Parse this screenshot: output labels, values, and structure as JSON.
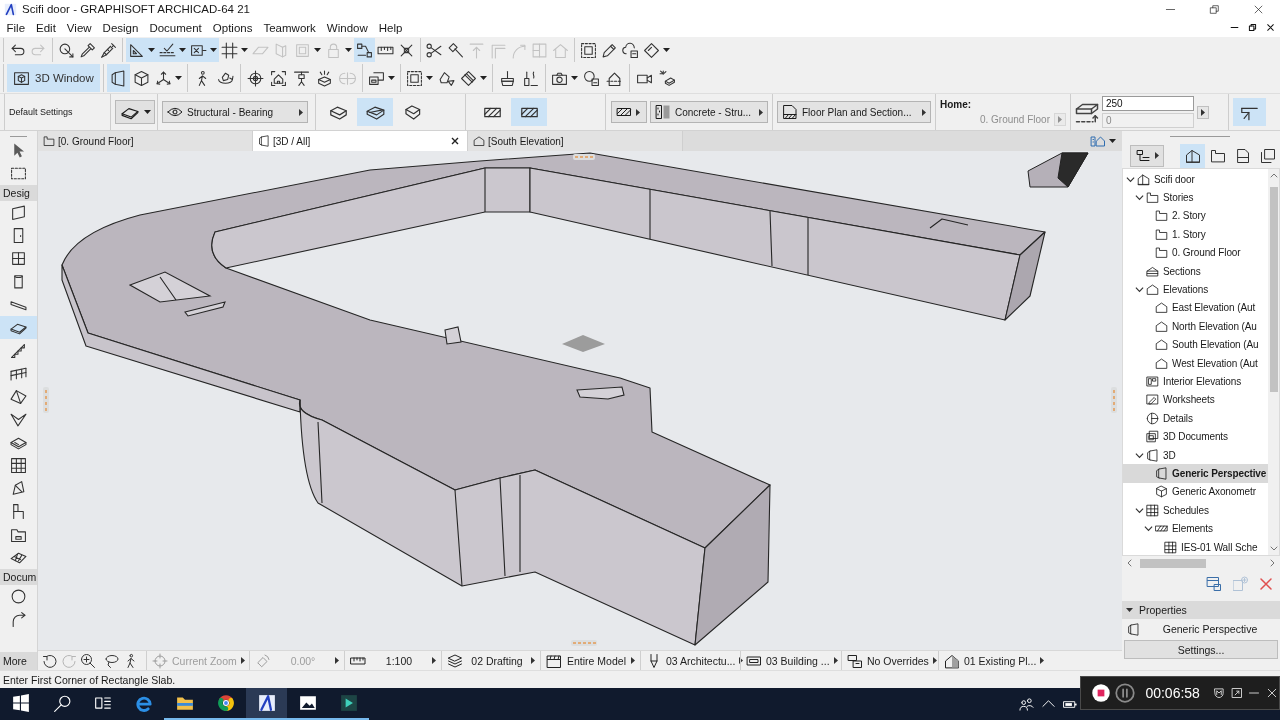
{
  "window": {
    "title": "Scifi door - GRAPHISOFT ARCHICAD-64 21"
  },
  "menu": [
    "File",
    "Edit",
    "View",
    "Design",
    "Document",
    "Options",
    "Teamwork",
    "Window",
    "Help"
  ],
  "toolbars": [
    {
      "groups": [
        [
          {
            "kind": "button",
            "on": false,
            "disabled": false
          },
          {
            "kind": "button",
            "on": false,
            "disabled": true
          }
        ],
        [
          {
            "kind": "button",
            "on": false,
            "disabled": false
          },
          {
            "kind": "button",
            "on": false,
            "disabled": false
          },
          {
            "kind": "button",
            "on": false,
            "disabled": false
          }
        ],
        [
          {
            "kind": "split",
            "on": true,
            "disabled": false
          },
          {
            "kind": "split",
            "on": true,
            "disabled": false
          },
          {
            "kind": "split",
            "on": true,
            "disabled": false
          },
          {
            "kind": "split",
            "on": false,
            "disabled": false
          },
          {
            "kind": "button",
            "on": false,
            "disabled": true
          },
          {
            "kind": "button",
            "on": false,
            "disabled": true
          },
          {
            "kind": "split",
            "on": false,
            "disabled": true
          },
          {
            "kind": "split",
            "on": false,
            "disabled": true
          },
          {
            "kind": "button",
            "on": true,
            "disabled": false
          },
          {
            "kind": "button",
            "on": false,
            "disabled": false
          },
          {
            "kind": "button",
            "on": false,
            "disabled": false
          }
        ],
        [
          {
            "kind": "button",
            "on": false,
            "disabled": false
          },
          {
            "kind": "button",
            "on": false,
            "disabled": false
          },
          {
            "kind": "button",
            "on": false,
            "disabled": true
          },
          {
            "kind": "button",
            "on": false,
            "disabled": true
          },
          {
            "kind": "button",
            "on": false,
            "disabled": true
          },
          {
            "kind": "button",
            "on": false,
            "disabled": true
          },
          {
            "kind": "button",
            "on": false,
            "disabled": true
          }
        ],
        [
          {
            "kind": "button",
            "on": false,
            "disabled": false
          },
          {
            "kind": "button",
            "on": false,
            "disabled": false
          },
          {
            "kind": "button",
            "on": false,
            "disabled": false
          },
          {
            "kind": "split",
            "on": false,
            "disabled": false
          }
        ]
      ]
    },
    {
      "groups": [
        [
          {
            "kind": "labeled",
            "label": "3D Window",
            "on": true,
            "disabled": false
          }
        ],
        [
          {
            "kind": "button",
            "on": true,
            "disabled": false
          },
          {
            "kind": "button",
            "on": false,
            "disabled": false
          },
          {
            "kind": "split",
            "on": false,
            "disabled": false
          }
        ],
        [
          {
            "kind": "button",
            "on": false,
            "disabled": false
          },
          {
            "kind": "button",
            "on": false,
            "disabled": false
          }
        ],
        [
          {
            "kind": "button",
            "on": false,
            "disabled": false
          },
          {
            "kind": "button",
            "on": false,
            "disabled": false
          },
          {
            "kind": "button",
            "on": false,
            "disabled": false
          },
          {
            "kind": "button",
            "on": false,
            "disabled": false
          },
          {
            "kind": "button",
            "on": false,
            "disabled": true
          }
        ],
        [
          {
            "kind": "split",
            "on": false,
            "disabled": false
          }
        ],
        [
          {
            "kind": "split",
            "on": false,
            "disabled": false
          },
          {
            "kind": "button",
            "on": false,
            "disabled": false
          },
          {
            "kind": "split",
            "on": false,
            "disabled": false
          }
        ],
        [
          {
            "kind": "button",
            "on": false,
            "disabled": false
          },
          {
            "kind": "button",
            "on": false,
            "disabled": false
          }
        ],
        [
          {
            "kind": "split",
            "on": false,
            "disabled": false
          },
          {
            "kind": "button",
            "on": false,
            "disabled": false
          },
          {
            "kind": "button",
            "on": false,
            "disabled": false
          }
        ],
        [
          {
            "kind": "button",
            "on": false,
            "disabled": false
          },
          {
            "kind": "button",
            "on": false,
            "disabled": false
          }
        ]
      ]
    }
  ],
  "info_box": {
    "title": "Default Settings",
    "structure": "Structural - Bearing",
    "geometry_methods": [
      {
        "selected": false
      },
      {
        "selected": true
      },
      {
        "selected": false
      }
    ],
    "fill_options": [
      {
        "selected": false
      },
      {
        "selected": true
      }
    ],
    "building_material": "Concrete - Stru...",
    "floor_plan_display": "Floor Plan and Section...",
    "home_label": "Home:",
    "home_story": {
      "value": "0. Ground Floor",
      "disabled": true
    },
    "thickness": {
      "value": "250",
      "disabled": false
    },
    "offset": {
      "value": "0",
      "disabled": true
    },
    "reference_line": {
      "on": true
    }
  },
  "toolbox": {
    "top_tools": [
      {
        "selected": false
      },
      {
        "selected": false
      }
    ],
    "sections": [
      {
        "label": "Desig",
        "tools": [
          {
            "selected": false
          },
          {
            "selected": false
          },
          {
            "selected": false
          },
          {
            "selected": false
          },
          {
            "selected": false
          },
          {
            "selected": true
          },
          {
            "selected": false
          },
          {
            "selected": false
          },
          {
            "selected": false
          },
          {
            "selected": false
          },
          {
            "selected": false
          },
          {
            "selected": false
          },
          {
            "selected": false
          },
          {
            "selected": false
          },
          {
            "selected": false
          },
          {
            "selected": false
          }
        ]
      },
      {
        "label": "Docum",
        "tools": [
          {
            "selected": false
          },
          {
            "selected": false
          }
        ]
      }
    ],
    "more": "More"
  },
  "tabs": [
    {
      "label": "[0. Ground Floor]",
      "kind": "story",
      "selected": false
    },
    {
      "label": "[3D / All]",
      "kind": "model",
      "selected": true
    },
    {
      "label": "[South Elevation]",
      "kind": "elevation",
      "selected": false
    }
  ],
  "status_bar": {
    "nav_buttons": [
      {
        "disabled": false
      },
      {
        "disabled": true
      },
      {
        "disabled": false
      },
      {
        "disabled": false
      },
      {
        "disabled": false
      }
    ],
    "fields": [
      {
        "kind": "zoom",
        "value": "Current Zoom",
        "disabled": true
      },
      {
        "kind": "angle",
        "value": "0.00°",
        "disabled": true
      },
      {
        "kind": "scale",
        "value": "1:100",
        "disabled": false
      },
      {
        "kind": "layers",
        "value": "02 Drafting",
        "disabled": false
      },
      {
        "kind": "model",
        "value": "Entire Model",
        "disabled": false
      },
      {
        "kind": "pen",
        "value": "03 Architectu...",
        "disabled": false
      },
      {
        "kind": "model_view",
        "value": "03 Building ...",
        "disabled": false
      },
      {
        "kind": "overrides",
        "value": "No Overrides",
        "disabled": false
      },
      {
        "kind": "renovation",
        "value": "01 Existing Pl...",
        "disabled": false
      }
    ]
  },
  "navigator": {
    "view_buttons": [
      {
        "selected": true
      },
      {
        "selected": false
      },
      {
        "selected": false
      },
      {
        "selected": false
      }
    ],
    "tree": [
      {
        "label": "Scifi door",
        "kind": "project",
        "selected": false,
        "expanded": true,
        "children": [
          {
            "label": "Stories",
            "kind": "stories",
            "selected": false,
            "expanded": true,
            "children": [
              {
                "label": "2. Story",
                "kind": "story",
                "selected": false
              },
              {
                "label": "1. Story",
                "kind": "story",
                "selected": false
              },
              {
                "label": "0. Ground Floor",
                "kind": "story",
                "selected": false
              }
            ]
          },
          {
            "label": "Sections",
            "kind": "sections",
            "selected": false
          },
          {
            "label": "Elevations",
            "kind": "elevations",
            "selected": false,
            "expanded": true,
            "children": [
              {
                "label": "East Elevation (Aut",
                "kind": "elevation",
                "selected": false
              },
              {
                "label": "North Elevation (Au",
                "kind": "elevation",
                "selected": false
              },
              {
                "label": "South Elevation (Au",
                "kind": "elevation",
                "selected": false
              },
              {
                "label": "West Elevation (Aut",
                "kind": "elevation",
                "selected": false
              }
            ]
          },
          {
            "label": "Interior Elevations",
            "kind": "interior_elevations",
            "selected": false
          },
          {
            "label": "Worksheets",
            "kind": "worksheets",
            "selected": false
          },
          {
            "label": "Details",
            "kind": "details",
            "selected": false
          },
          {
            "label": "3D Documents",
            "kind": "documents_3d",
            "selected": false
          },
          {
            "label": "3D",
            "kind": "folder_3d",
            "selected": false,
            "expanded": true,
            "children": [
              {
                "label": "Generic Perspective",
                "kind": "perspective",
                "selected": true
              },
              {
                "label": "Generic Axonometr",
                "kind": "axonometry",
                "selected": false
              }
            ]
          },
          {
            "label": "Schedules",
            "kind": "schedules",
            "selected": false,
            "expanded": true,
            "children": [
              {
                "label": "Elements",
                "kind": "elements",
                "selected": false,
                "expanded": true,
                "children": [
                  {
                    "label": "IES-01 Wall Sche",
                    "kind": "schedule",
                    "selected": false
                  }
                ]
              }
            ]
          }
        ]
      }
    ],
    "bottom_buttons": [
      {
        "disabled": false
      },
      {
        "disabled": true
      },
      {
        "disabled": false
      }
    ]
  },
  "properties": {
    "title": "Properties",
    "expanded": true,
    "name": "Generic Perspective",
    "button": "Settings..."
  },
  "hint": "Enter First Corner of Rectangle Slab.",
  "taskbar": {
    "apps": [
      {
        "kind": "e-logo",
        "running": false,
        "selected": false
      },
      {
        "kind": "folder",
        "running": true,
        "selected": false
      },
      {
        "kind": "ring-logo",
        "running": true,
        "selected": false
      },
      {
        "kind": "a-logo",
        "running": true,
        "selected": true
      },
      {
        "kind": "picture",
        "running": true,
        "selected": false
      },
      {
        "kind": "tile-logo",
        "running": true,
        "selected": false
      }
    ]
  },
  "recorder": {
    "time": "00:06:58",
    "recording": true
  }
}
